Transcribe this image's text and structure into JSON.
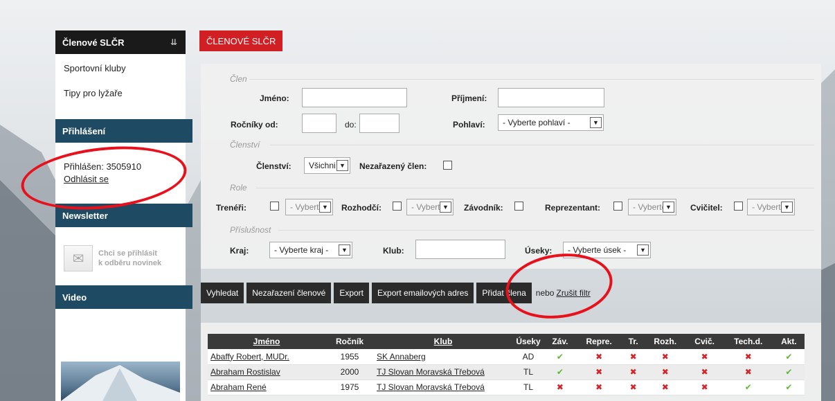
{
  "sidebar": {
    "header": "Členové SLČR",
    "links": [
      "Sportovní kluby",
      "Tipy pro lyžaře"
    ],
    "login_section": "Přihlášení",
    "logged_in_label": "Přihlášen:",
    "logged_in_id": "3505910",
    "logout_link": "Odhlásit se",
    "newsletter_section": "Newsletter",
    "newsletter_text_line1": "Chci se přihlásit",
    "newsletter_text_line2": "k odběru novinek",
    "video_section": "Video"
  },
  "page_title": "ČLENOVÉ SLČR",
  "filters": {
    "clen": {
      "legend": "Člen",
      "jmeno_label": "Jméno:",
      "prijmeni_label": "Příjmení:",
      "rocniky_od_label": "Ročníky od:",
      "do_label": "do:",
      "pohlavi_label": "Pohlaví:",
      "pohlavi_value": "- Vyberte pohlaví -"
    },
    "clenstvi": {
      "legend": "Členství",
      "clenstvi_label": "Členství:",
      "clenstvi_value": "Všichni",
      "nezarazeny_label": "Nezařazený člen:"
    },
    "role": {
      "legend": "Role",
      "treneri_label": "Trenéři:",
      "rozhodci_label": "Rozhodčí:",
      "zavodnik_label": "Závodník:",
      "reprezentant_label": "Reprezentant:",
      "cvicitel_label": "Cvičitel:",
      "select_value": "- Vyberte -"
    },
    "prislusnost": {
      "legend": "Příslušnost",
      "kraj_label": "Kraj:",
      "kraj_value": "- Vyberte kraj -",
      "klub_label": "Klub:",
      "useky_label": "Úseky:",
      "useky_value": "- Vyberte úsek -"
    }
  },
  "buttons": {
    "search": "Vyhledat",
    "unassigned": "Nezařazení členové",
    "export": "Export",
    "export_emails": "Export emailových adres",
    "add_member": "Přidat člena",
    "or_text": "nebo",
    "clear_filter": "Zrušit filtr"
  },
  "table": {
    "headers": [
      "Jméno",
      "Ročník",
      "Klub",
      "Úseky",
      "Záv.",
      "Repre.",
      "Tr.",
      "Rozh.",
      "Cvič.",
      "Tech.d.",
      "Akt."
    ],
    "rows": [
      {
        "name": "Abaffy Robert, MUDr.",
        "year": "1955",
        "club": "SK Annaberg",
        "useky": "AD",
        "flags": [
          true,
          false,
          false,
          false,
          false,
          false,
          true
        ]
      },
      {
        "name": "Abraham Rostislav",
        "year": "2000",
        "club": "TJ Slovan Moravská Třebová",
        "useky": "TL",
        "flags": [
          true,
          false,
          false,
          false,
          false,
          false,
          true
        ]
      },
      {
        "name": "Abraham René",
        "year": "1975",
        "club": "TJ Slovan Moravská Třebová",
        "useky": "TL",
        "flags": [
          false,
          false,
          false,
          false,
          false,
          true,
          true
        ]
      }
    ]
  },
  "colors": {
    "accent_red": "#d21f24",
    "section_blue": "#1e4b63",
    "check_green": "#5fb832",
    "cross_red": "#d4242a",
    "annotation_red": "#e8101b"
  }
}
